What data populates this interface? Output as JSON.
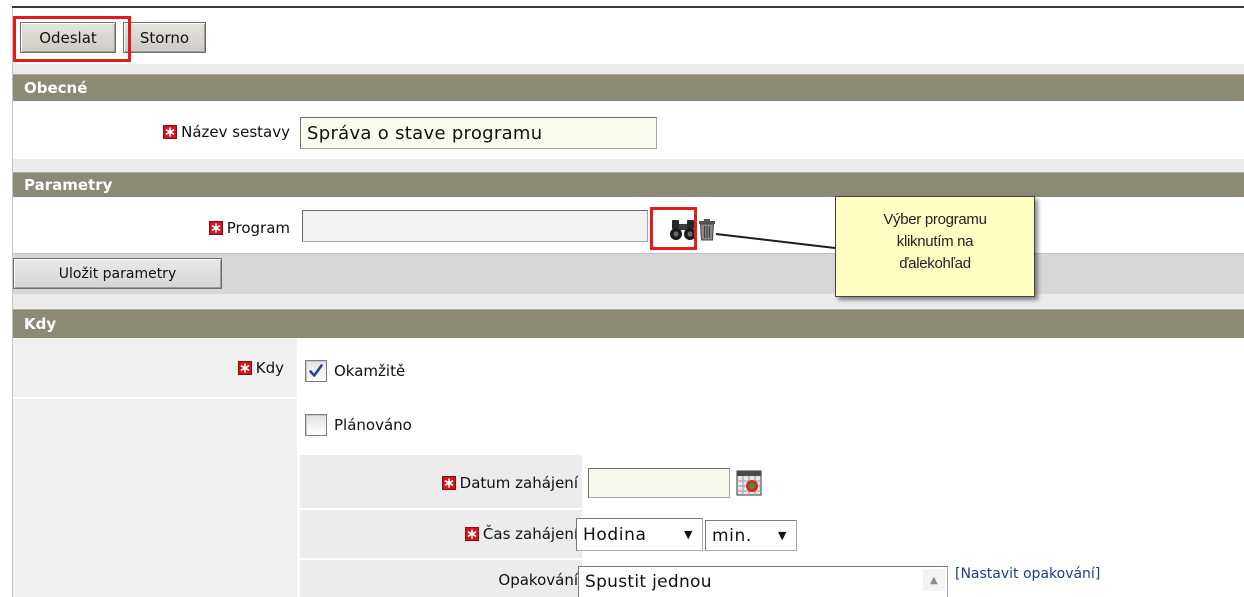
{
  "toolbar": {
    "submit_label": "Odeslat",
    "cancel_label": "Storno"
  },
  "general": {
    "title": "Obecné",
    "report_name_label": "Název sestavy",
    "report_name_value": "Správa o stave programu"
  },
  "parameters": {
    "title": "Parametry",
    "program_label": "Program",
    "program_value": "",
    "save_label": "Uložit parametry"
  },
  "schedule": {
    "title": "Kdy",
    "when_label": "Kdy",
    "options": [
      {
        "label": "Okamžitě",
        "checked": true
      },
      {
        "label": "Plánováno",
        "checked": false
      }
    ],
    "start_date_label": "Datum zahájení",
    "start_date_value": "",
    "start_time_label": "Čas zahájení",
    "hour_value": "Hodina",
    "minute_value": "min.",
    "repeat_label": "Opakování",
    "repeat_value": "Spustit jednou",
    "set_repeat_link": "[Nastavit opakování]"
  },
  "callout": {
    "lines": [
      "Výber programu",
      "kliknutím na",
      "ďalekohľad"
    ]
  },
  "icons": {
    "required": "required-icon",
    "search": "binoculars-icon",
    "clear": "trash-icon",
    "calendar": "calendar-icon",
    "dropdown": "dropdown-arrow-icon",
    "scroll": "scroll-up-arrow-icon",
    "check": "checkmark-icon"
  },
  "colors": {
    "section_header": "#8c8a76",
    "highlight": "#e31b1b",
    "callout_bg": "#ffffc4",
    "required": "#d4141f",
    "link": "#1c3c8c"
  }
}
